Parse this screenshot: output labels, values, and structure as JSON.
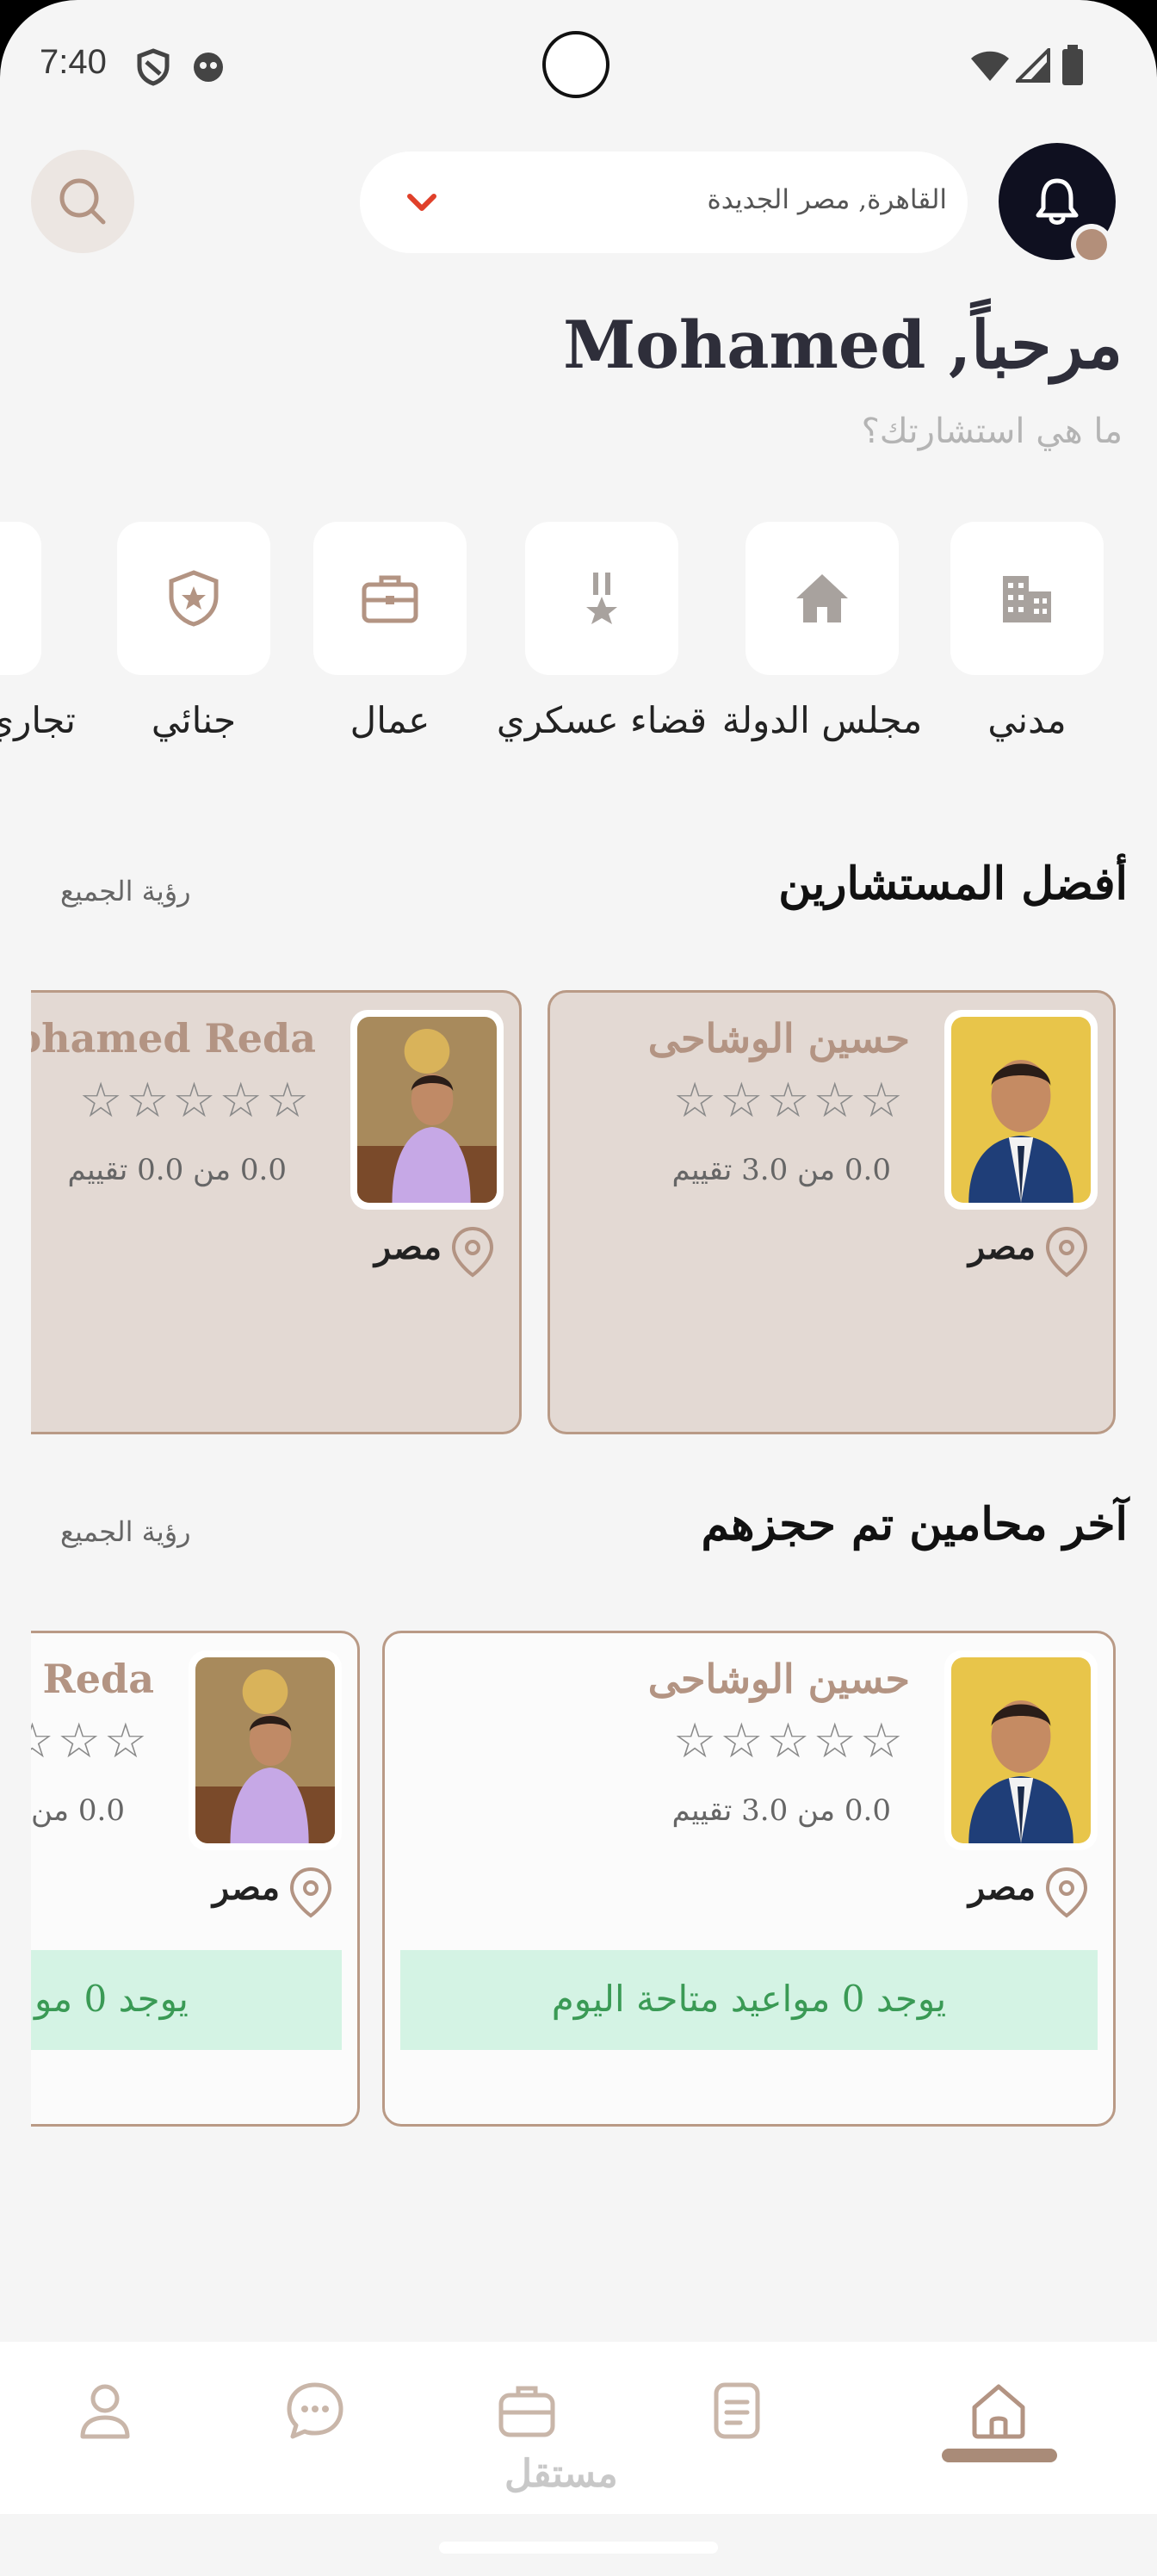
{
  "status_bar": {
    "time": "7:40"
  },
  "header": {
    "location": "القاهرة, مصر الجديدة",
    "greeting": "مرحباً, Mohamed",
    "subtitle": "ما هي استشارتك؟"
  },
  "categories": [
    {
      "label": "مدني",
      "icon": "building-icon"
    },
    {
      "label": "مجلس الدولة",
      "icon": "house-icon"
    },
    {
      "label": "قضاء عسكري",
      "icon": "medal-icon"
    },
    {
      "label": "عمال",
      "icon": "briefcase-icon"
    },
    {
      "label": "جنائي",
      "icon": "shield-star-icon"
    },
    {
      "label": "تجاري",
      "icon": "store-icon"
    }
  ],
  "best_section": {
    "title": "أفضل المستشارين",
    "see_all": "رؤية الجميع"
  },
  "recent_section": {
    "title": "آخر محامين تم حجزهم",
    "see_all": "رؤية الجميع"
  },
  "lawyers": [
    {
      "name": "حسين الوشاحى",
      "rating": "0.0 من 3.0 تقييم",
      "stars": 0,
      "country": "مصر"
    },
    {
      "name": "Mohamed Reda",
      "rating": "0.0 من 0.0 تقييم",
      "stars": 0,
      "country": "مصر"
    }
  ],
  "availability": "يوجد 0 مواعيد متاحة اليوم",
  "bottom_nav": [
    {
      "name": "home",
      "icon": "home-icon",
      "active": true
    },
    {
      "name": "documents",
      "icon": "document-icon",
      "active": false
    },
    {
      "name": "services",
      "icon": "briefcase-icon",
      "active": false
    },
    {
      "name": "chat",
      "icon": "chat-icon",
      "active": false
    },
    {
      "name": "profile",
      "icon": "user-icon",
      "active": false
    }
  ],
  "watermark": "مستقل",
  "colors": {
    "accent": "#b39483",
    "dark": "#0f1020",
    "card_bg": "#e3d9d3",
    "available_bg": "#d4f3e4",
    "available_text": "#3a9a55"
  }
}
